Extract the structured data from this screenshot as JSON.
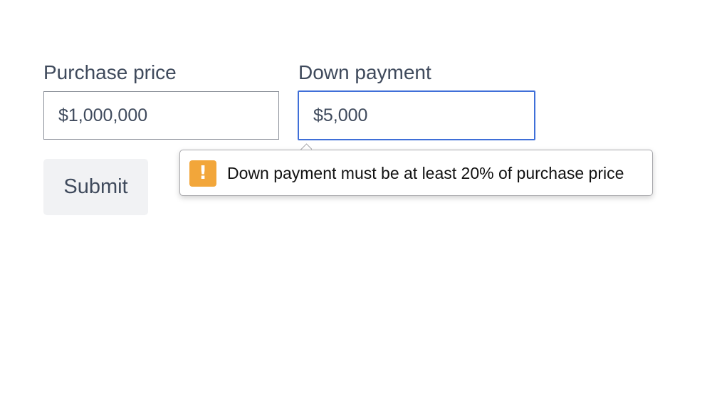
{
  "form": {
    "purchase_price": {
      "label": "Purchase price",
      "value": "$1,000,000"
    },
    "down_payment": {
      "label": "Down payment",
      "value": "$5,000"
    },
    "submit_label": "Submit"
  },
  "validation": {
    "icon": "warning-icon",
    "icon_glyph": "!",
    "message": "Down payment must be at least 20% of purchase price"
  },
  "colors": {
    "focus_border": "#3f6fd8",
    "warning": "#f2a63a",
    "button_background": "#f1f2f4"
  }
}
